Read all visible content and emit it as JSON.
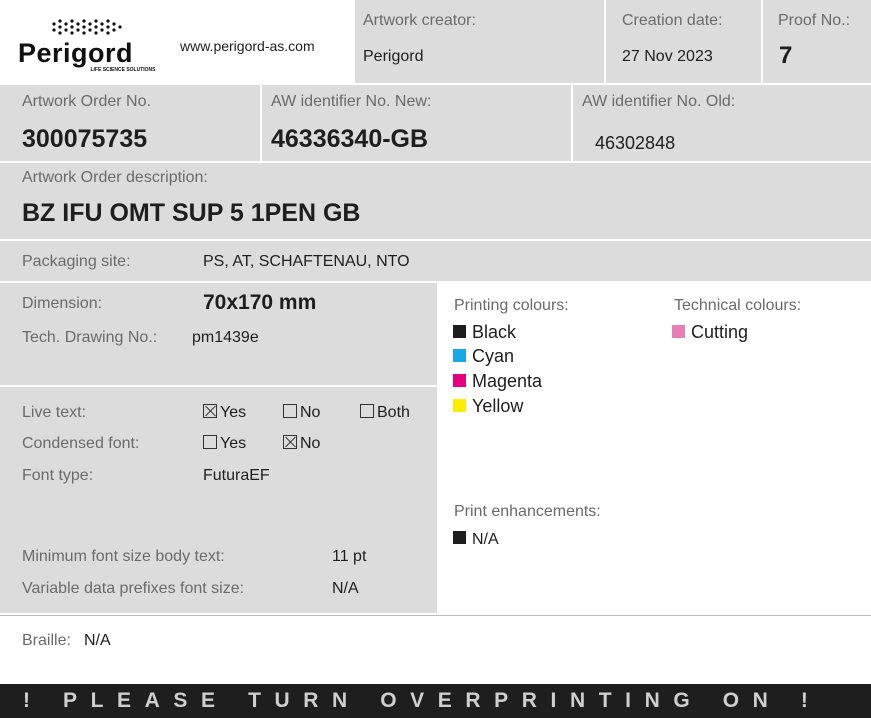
{
  "header": {
    "logo_text": "Perigord",
    "logo_sub": "LIFE SCIENCE SOLUTIONS",
    "website": "www.perigord-as.com",
    "artwork_creator_label": "Artwork creator:",
    "artwork_creator_value": "Perigord",
    "creation_date_label": "Creation date:",
    "creation_date_value": "27 Nov 2023",
    "proof_label": "Proof No.:",
    "proof_value": "7"
  },
  "ids": {
    "order_no_label": "Artwork Order No.",
    "order_no_value": "300075735",
    "aw_new_label": "AW identifier No. New:",
    "aw_new_value": "46336340-GB",
    "aw_old_label": "AW identifier No. Old:",
    "aw_old_value": "46302848"
  },
  "description": {
    "label": "Artwork Order description:",
    "value": "BZ IFU OMT SUP 5 1PEN GB"
  },
  "packaging": {
    "label": "Packaging site:",
    "value": "PS, AT, SCHAFTENAU, NTO"
  },
  "dimension": {
    "label": "Dimension:",
    "value": "70x170 mm",
    "drawing_label": "Tech. Drawing No.:",
    "drawing_value": "pm1439e"
  },
  "text_options": {
    "live_text_label": "Live text:",
    "live_yes": "Yes",
    "live_no": "No",
    "live_both": "Both",
    "live_text_selected": "Yes",
    "condensed_label": "Condensed font:",
    "cond_yes": "Yes",
    "cond_no": "No",
    "condensed_selected": "No",
    "font_type_label": "Font type:",
    "font_type_value": "FuturaEF",
    "min_font_label": "Minimum font size body text:",
    "min_font_value": "11 pt",
    "variable_label": "Variable data prefixes font size:",
    "variable_value": "N/A"
  },
  "printing_colours": {
    "label": "Printing colours:",
    "items": [
      {
        "name": "Black",
        "color": "#1e1e1e"
      },
      {
        "name": "Cyan",
        "color": "#1aa7e6"
      },
      {
        "name": "Magenta",
        "color": "#e4007e"
      },
      {
        "name": "Yellow",
        "color": "#ffec00"
      }
    ]
  },
  "technical_colours": {
    "label": "Technical colours:",
    "items": [
      {
        "name": "Cutting",
        "color": "#e67fb4"
      }
    ]
  },
  "enhancements": {
    "label": "Print enhancements:",
    "value": "N/A",
    "color": "#1e1e1e"
  },
  "braille": {
    "label": "Braille:",
    "value": "N/A"
  },
  "banner": {
    "text": "! PLEASE TURN OVERPRINTING ON !"
  }
}
